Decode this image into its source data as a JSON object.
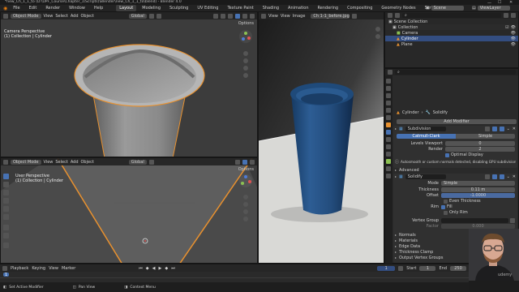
{
  "window_title": "*new_Ch_1_1_to (D:\\UPF_Course\\Chapter_1\\Scripts)\\Blender\\new_Ch_1_1_to\\blend) - Blender 4.0",
  "menu": [
    "File",
    "Edit",
    "Render",
    "Window",
    "Help"
  ],
  "workspaces": [
    "Layout",
    "Modeling",
    "Sculpting",
    "UV Editing",
    "Texture Paint",
    "Shading",
    "Animation",
    "Rendering",
    "Compositing",
    "Geometry Nodes",
    "Scripting"
  ],
  "active_workspace": "Layout",
  "scene": "Scene",
  "view_layer": "ViewLayer",
  "vp_top_left": {
    "mode": "Object Mode",
    "menus": [
      "View",
      "Select",
      "Add",
      "Object"
    ],
    "orientation": "Global",
    "options": "Options",
    "overlay_title": "Camera Perspective",
    "overlay_sub": "(1) Collection | Cylinder"
  },
  "vp_bottom_left": {
    "mode": "Object Mode",
    "menus": [
      "View",
      "Select",
      "Add",
      "Object"
    ],
    "orientation": "Global",
    "options": "Options",
    "overlay_title": "User Perspective",
    "overlay_sub": "(1) Collection | Cylinder"
  },
  "image_editor": {
    "menus": [
      "View",
      "View",
      "Image"
    ],
    "image_name": "Ch 1-1_before.jpg"
  },
  "outliner": {
    "items": [
      {
        "label": "Scene Collection",
        "selected": false
      },
      {
        "label": "Collection",
        "selected": false
      },
      {
        "label": "Camera",
        "selected": false
      },
      {
        "label": "Cylinder",
        "selected": true
      },
      {
        "label": "Plane",
        "selected": false
      }
    ]
  },
  "properties": {
    "breadcrumb_obj": "Cylinder",
    "breadcrumb_mod": "Solidify",
    "add_modifier": "Add Modifier",
    "subdivision": {
      "name": "Subdivision",
      "tabs": [
        "Catmull-Clark",
        "Simple"
      ],
      "levels_label": "Levels Viewport",
      "levels": "0",
      "render_label": "Render",
      "render": "2",
      "optimal": "Optimal Display"
    },
    "autosmooth_notice": "Autosmooth or custom normals detected, disabling GPU subdivision",
    "advanced": "Advanced",
    "solidify": {
      "name": "Solidify",
      "mode_label": "Mode",
      "mode": "Simple",
      "thickness_label": "Thickness",
      "thickness": "0.11 m",
      "offset_label": "Offset",
      "offset": "-1.0000",
      "even": "Even Thickness",
      "rim_label": "Rim",
      "fill": "Fill",
      "only_rim": "Only Rim",
      "vgroup_label": "Vertex Group",
      "factor_label": "Factor",
      "factor": "0.000"
    },
    "panels": [
      "Normals",
      "Materials",
      "Edge Data",
      "Thickness Clamp",
      "Output Vertex Groups"
    ]
  },
  "timeline": {
    "menus": [
      "Playback",
      "Keying",
      "View",
      "Marker"
    ],
    "frame": "1",
    "start_label": "Start",
    "start": "1",
    "end_label": "End",
    "end": "250"
  },
  "status": {
    "items": [
      "Set Active Modifier",
      "Pan View",
      "Context Menu"
    ]
  },
  "udemy": "udemy"
}
